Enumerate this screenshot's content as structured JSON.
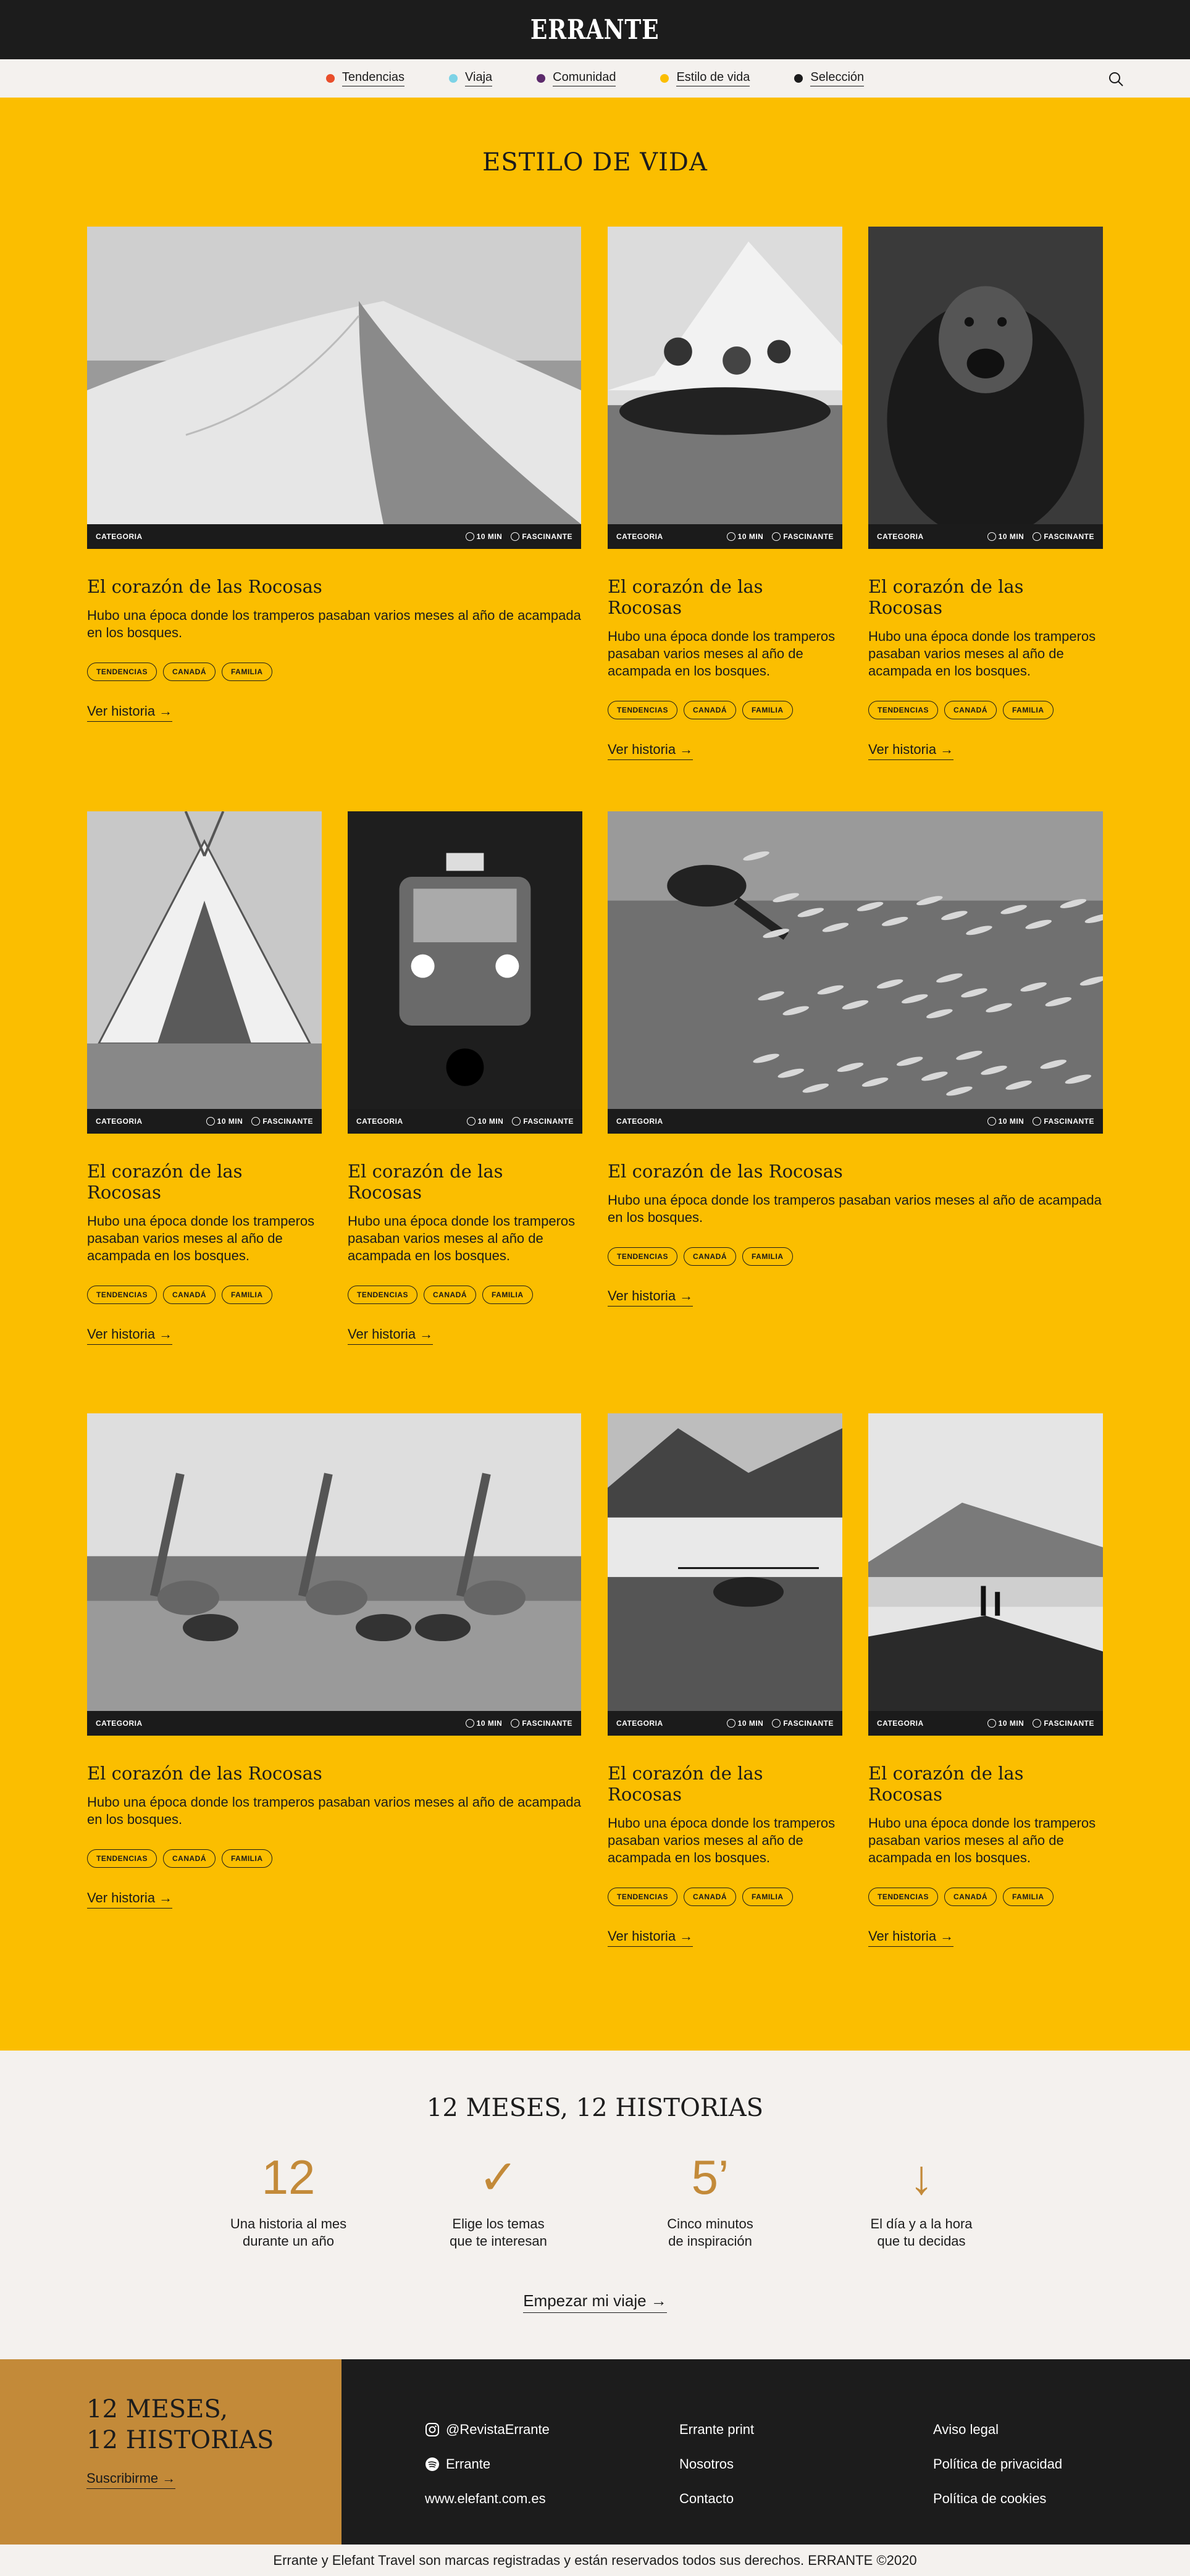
{
  "header": {
    "logo": "ERRANTE"
  },
  "nav": {
    "items": [
      {
        "label": "Tendencias",
        "color": "#e94e2b"
      },
      {
        "label": "Viaja",
        "color": "#7dd3e6"
      },
      {
        "label": "Comunidad",
        "color": "#5c2a6b"
      },
      {
        "label": "Estilo de vida",
        "color": "#fbbe00"
      },
      {
        "label": "Selección",
        "color": "#1c1c1c"
      }
    ],
    "search_icon": "search-icon"
  },
  "section": {
    "title": "ESTILO DE VIDA"
  },
  "card_common": {
    "category": "CATEGORIA",
    "time": "10 MIN",
    "mood": "FASCINANTE",
    "title": "El corazón de las Rocosas",
    "desc": "Hubo una época donde los tramperos pasaban varios meses al año de acampada en los bosques.",
    "tags": [
      "TENDENCIAS",
      "CANADÁ",
      "FAMILIA"
    ],
    "more": "Ver historia →"
  },
  "cards": [
    {
      "photo": "desert-dunes"
    },
    {
      "photo": "boat-antarctica"
    },
    {
      "photo": "chimpanzee"
    },
    {
      "photo": "glamping-tent"
    },
    {
      "photo": "tuk-tuk"
    },
    {
      "photo": "diver-fish"
    },
    {
      "photo": "giraffes-zebras"
    },
    {
      "photo": "helicopter-glacier"
    },
    {
      "photo": "hikers-fjord"
    }
  ],
  "stats": {
    "title": "12 MESES, 12 HISTORIAS",
    "items": [
      {
        "big": "12",
        "line1": "Una historia al mes",
        "line2": "durante un año"
      },
      {
        "big": "✓",
        "line1": "Elige los temas",
        "line2": "que te interesan"
      },
      {
        "big": "5’",
        "line1": "Cinco minutos",
        "line2": "de inspiración"
      },
      {
        "big": "↓",
        "line1": "El día y a la hora",
        "line2": "que tu decidas"
      }
    ],
    "cta": "Empezar mi viaje →"
  },
  "footer": {
    "promo_line1": "12 MESES,",
    "promo_line2": "12 HISTORIAS",
    "subscribe": "Suscribirme →",
    "social": [
      {
        "icon": "instagram-icon",
        "label": "@RevistaErrante"
      },
      {
        "icon": "spotify-icon",
        "label": "Errante"
      },
      {
        "icon": "",
        "label": "www.elefant.com.es"
      }
    ],
    "col2": [
      "Errante print",
      "Nosotros",
      "Contacto"
    ],
    "col3": [
      "Aviso legal",
      "Política de privacidad",
      "Política de cookies"
    ],
    "copyright": "Errante y Elefant Travel son marcas registradas y están reservados todos sus derechos. ERRANTE ©2020"
  }
}
